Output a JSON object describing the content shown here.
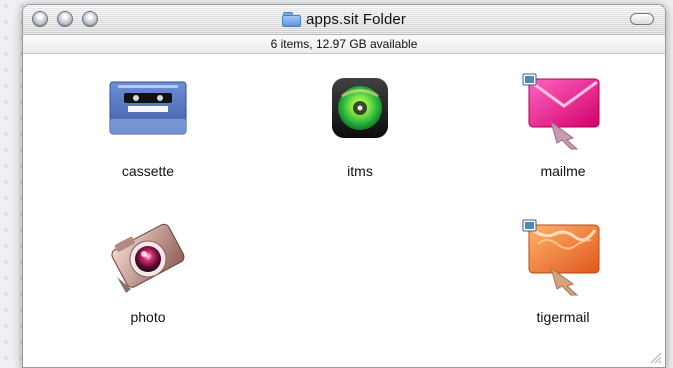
{
  "window": {
    "title": "apps.sit Folder",
    "status": "6 items, 12.97 GB available"
  },
  "items": [
    {
      "label": "cassette",
      "icon": "cassette-icon"
    },
    {
      "label": "itms",
      "icon": "itms-icon"
    },
    {
      "label": "mailme",
      "icon": "mailme-icon"
    },
    {
      "label": "photo",
      "icon": "photo-icon"
    },
    {
      "label": "tigermail",
      "icon": "tigermail-icon"
    }
  ],
  "colors": {
    "accent_green": "#39b54a",
    "accent_pink": "#ef2a8f",
    "accent_orange": "#f07f2e"
  }
}
